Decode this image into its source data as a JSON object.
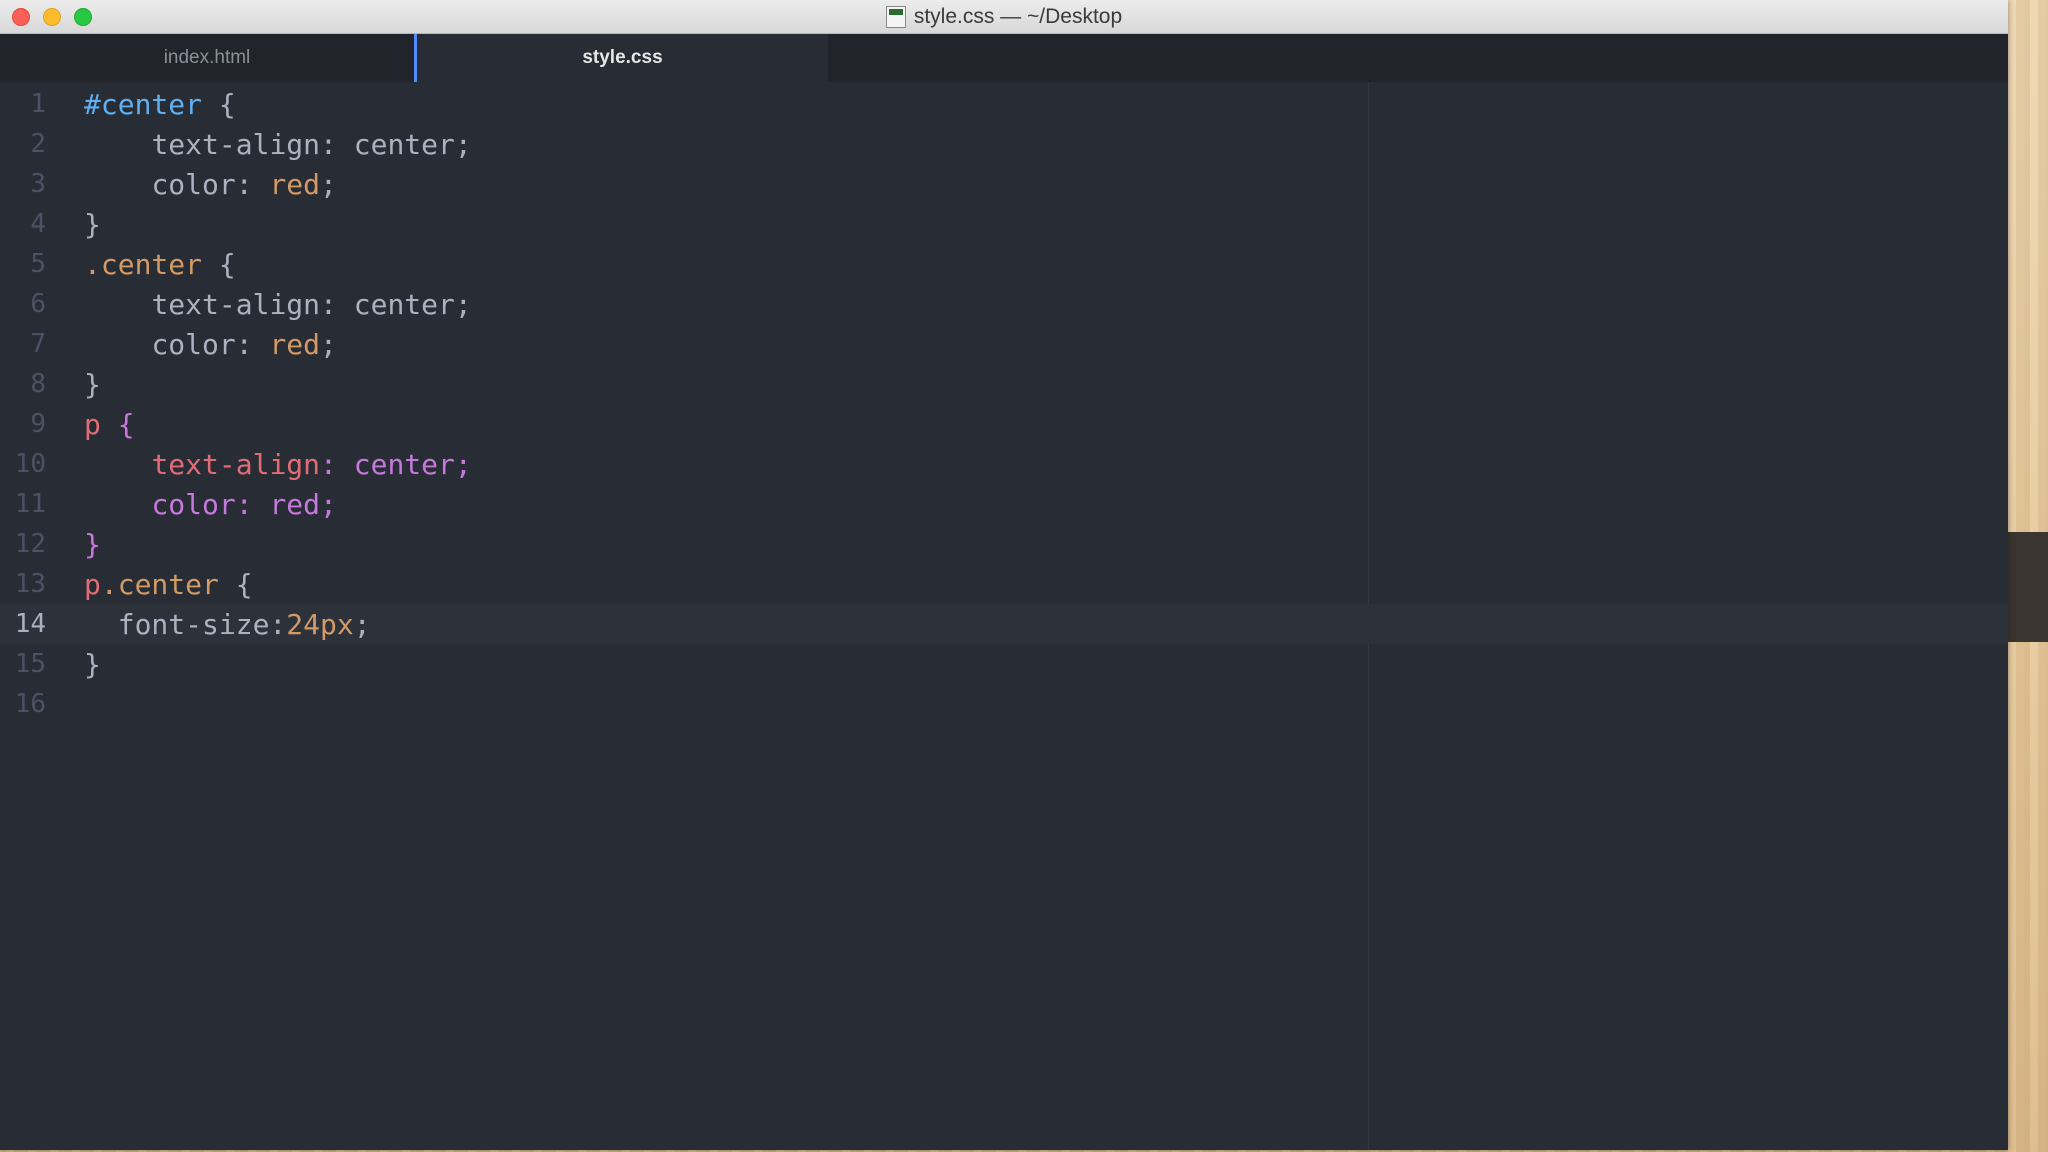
{
  "window": {
    "title": "style.css — ~/Desktop"
  },
  "tabs": [
    {
      "label": "index.html",
      "active": false
    },
    {
      "label": "style.css",
      "active": true
    }
  ],
  "editor": {
    "active_line": 14,
    "lines": [
      {
        "n": "1"
      },
      {
        "n": "2"
      },
      {
        "n": "3"
      },
      {
        "n": "4"
      },
      {
        "n": "5"
      },
      {
        "n": "6"
      },
      {
        "n": "7"
      },
      {
        "n": "8"
      },
      {
        "n": "9"
      },
      {
        "n": "10"
      },
      {
        "n": "11"
      },
      {
        "n": "12"
      },
      {
        "n": "13"
      },
      {
        "n": "14"
      },
      {
        "n": "15"
      },
      {
        "n": "16"
      }
    ],
    "code": {
      "l1_sel": "#center",
      "l1_rest": " {",
      "l2_prop": "text-align",
      "l2_val": "center",
      "l3_prop": "color",
      "l3_val": "red",
      "l4": "}",
      "l5_sel": ".center",
      "l5_rest": " {",
      "l6_prop": "text-align",
      "l6_val": "center",
      "l7_prop": "color",
      "l7_val": "red",
      "l8": "}",
      "l9_sel": "p",
      "l9_brace": "{",
      "l10_prop": "text-align",
      "l10_val": "center",
      "l11_prop": "color",
      "l11_val": "red",
      "l12": "}",
      "l13_tag": "p",
      "l13_cls": ".center",
      "l13_rest": " {",
      "l14_prop": "font-size:",
      "l14_val": "24px",
      "l15": "}"
    }
  },
  "colors": {
    "editor_bg": "#282c34",
    "tab_bar_bg": "#21252b",
    "accent": "#528bff"
  }
}
